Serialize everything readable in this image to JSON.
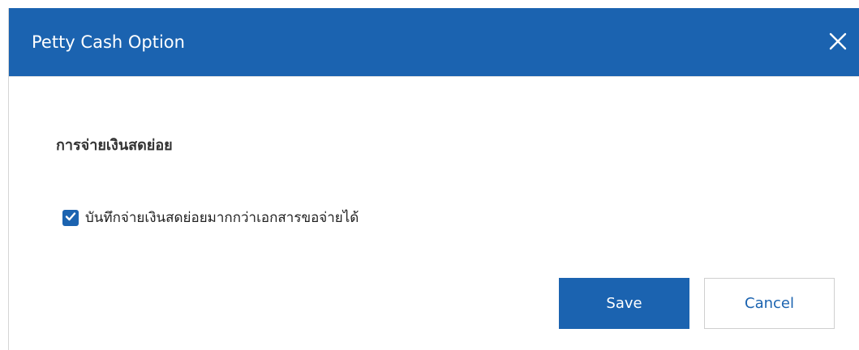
{
  "dialog": {
    "title": "Petty Cash Option",
    "close_icon": "close-icon",
    "section_heading": "การจ่ายเงินสดย่อย",
    "option": {
      "label": "บันทึกจ่ายเงินสดย่อยมากกว่าเอกสารขอจ่ายได้",
      "checked": true
    },
    "buttons": {
      "save": "Save",
      "cancel": "Cancel"
    }
  },
  "colors": {
    "accent": "#1b63b0",
    "header_text": "#ffffff",
    "cancel_border": "#cfcfcf"
  }
}
